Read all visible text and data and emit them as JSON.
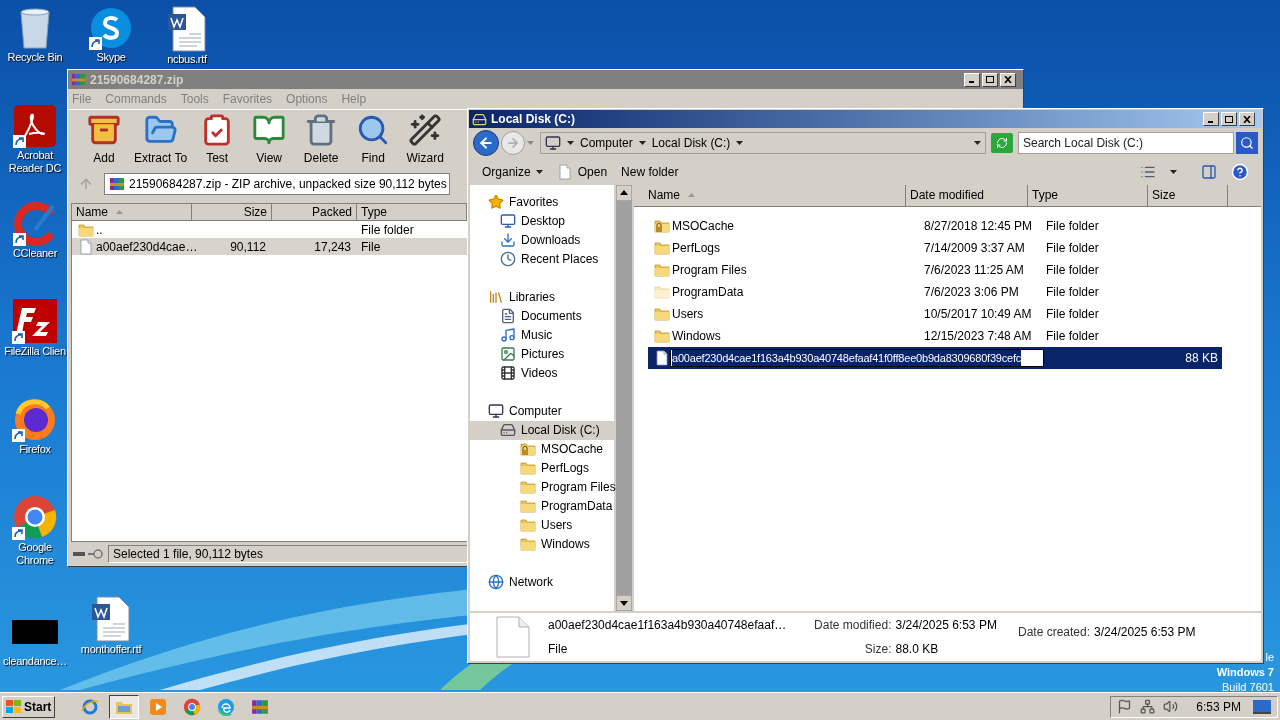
{
  "desktop": {
    "icons": [
      {
        "label": "Recycle Bin",
        "kind": "recycle",
        "shortcut": false
      },
      {
        "label": "Skype",
        "kind": "skype",
        "shortcut": true
      },
      {
        "label": "ncbus.rtf",
        "kind": "word",
        "shortcut": false
      },
      {
        "label": "Acrobat Reader DC",
        "kind": "acrobat",
        "shortcut": true
      },
      {
        "label": "CCleaner",
        "kind": "ccleaner",
        "shortcut": true
      },
      {
        "label": "FileZilla Clien",
        "kind": "filezilla",
        "shortcut": true
      },
      {
        "label": "Firefox",
        "kind": "firefox",
        "shortcut": true
      },
      {
        "label": "Google Chrome",
        "kind": "chrome",
        "shortcut": true
      },
      {
        "label": "cleandance…",
        "kind": "thumbnail",
        "shortcut": false
      },
      {
        "label": "monthoffer.rtf",
        "kind": "word",
        "shortcut": false
      }
    ],
    "os_lines": [
      "le",
      "Windows 7",
      "Build 7601"
    ]
  },
  "winrar": {
    "title": "21590684287.zip",
    "active": false,
    "menu": [
      "File",
      "Commands",
      "Tools",
      "Favorites",
      "Options",
      "Help"
    ],
    "tools": [
      {
        "label": "Add",
        "kind": "add"
      },
      {
        "label": "Extract To",
        "kind": "extract"
      },
      {
        "label": "Test",
        "kind": "test"
      },
      {
        "label": "View",
        "kind": "view"
      },
      {
        "label": "Delete",
        "kind": "delete"
      },
      {
        "label": "Find",
        "kind": "find"
      },
      {
        "label": "Wizard",
        "kind": "wizard"
      }
    ],
    "address": "21590684287.zip - ZIP archive, unpacked size 90,112 bytes",
    "columns": [
      "Name",
      "Size",
      "Packed",
      "Type"
    ],
    "rows": [
      {
        "kind": "folder",
        "name": "..",
        "type": "File folder",
        "selected": false
      },
      {
        "kind": "file",
        "name": "a00aef230d4cae…",
        "size": "90,112",
        "packed": "17,243",
        "type": "File",
        "selected": true
      }
    ],
    "status": "Selected 1 file, 90,112 bytes"
  },
  "explorer": {
    "title": "Local Disk (C:)",
    "active": true,
    "breadcrumb": [
      "Computer",
      "Local Disk (C:)"
    ],
    "search": {
      "placeholder": "Search Local Disk (C:)"
    },
    "commands": [
      {
        "label": "Organize",
        "kind": "menu"
      },
      {
        "label": "Open",
        "kind": "open"
      },
      {
        "label": "New folder",
        "kind": "plain"
      }
    ],
    "nav": [
      {
        "label": "Favorites",
        "kind": "star",
        "selected": false,
        "children": [
          {
            "label": "Desktop",
            "kind": "desktop",
            "selected": false
          },
          {
            "label": "Downloads",
            "kind": "downloads",
            "selected": false
          },
          {
            "label": "Recent Places",
            "kind": "recent",
            "selected": false
          }
        ]
      },
      {
        "label": "Libraries",
        "kind": "library",
        "selected": false,
        "children": [
          {
            "label": "Documents",
            "kind": "documents",
            "selected": false
          },
          {
            "label": "Music",
            "kind": "music",
            "selected": false
          },
          {
            "label": "Pictures",
            "kind": "pictures",
            "selected": false
          },
          {
            "label": "Videos",
            "kind": "videos",
            "selected": false
          }
        ]
      },
      {
        "label": "Computer",
        "kind": "computer",
        "selected": false,
        "children": [
          {
            "label": "Local Disk (C:)",
            "kind": "drive",
            "selected": true,
            "children": [
              {
                "label": "MSOCache",
                "kind": "folder-locked",
                "selected": false
              },
              {
                "label": "PerfLogs",
                "kind": "folder",
                "selected": false
              },
              {
                "label": "Program Files",
                "kind": "folder",
                "selected": false
              },
              {
                "label": "ProgramData",
                "kind": "folder",
                "selected": false
              },
              {
                "label": "Users",
                "kind": "folder",
                "selected": false
              },
              {
                "label": "Windows",
                "kind": "folder",
                "selected": false
              }
            ]
          }
        ]
      },
      {
        "label": "Network",
        "kind": "network",
        "selected": false
      }
    ],
    "columns": [
      "Name",
      "Date modified",
      "Type",
      "Size"
    ],
    "rows": [
      {
        "kind": "folder-locked",
        "name": "MSOCache",
        "date": "8/27/2018 12:45 PM",
        "type": "File folder",
        "selected": false,
        "editing": false
      },
      {
        "kind": "folder",
        "name": "PerfLogs",
        "date": "7/14/2009 3:37 AM",
        "type": "File folder",
        "selected": false,
        "editing": false
      },
      {
        "kind": "folder",
        "name": "Program Files",
        "date": "7/6/2023 11:25 AM",
        "type": "File folder",
        "selected": false,
        "editing": false
      },
      {
        "kind": "folder-hidden",
        "name": "ProgramData",
        "date": "7/6/2023 3:06 PM",
        "type": "File folder",
        "selected": false,
        "editing": false
      },
      {
        "kind": "folder",
        "name": "Users",
        "date": "10/5/2017 10:49 AM",
        "type": "File folder",
        "selected": false,
        "editing": false
      },
      {
        "kind": "folder",
        "name": "Windows",
        "date": "12/15/2023 7:48 AM",
        "type": "File folder",
        "selected": false,
        "editing": false
      },
      {
        "kind": "file",
        "name": "a00aef230d4cae1f163a4b930a40748efaaf41f0ff8ee0b9da8309680f39cefc",
        "size": "88 KB",
        "selected": true,
        "editing": true
      }
    ],
    "details": {
      "name": "a00aef230d4cae1f163a4b930a40748efaaf…",
      "type": "File",
      "fields": [
        {
          "label": "Date modified:",
          "value": "3/24/2025 6:53 PM"
        },
        {
          "label": "Size:",
          "value": "88.0 KB"
        },
        {
          "label": "Date created:",
          "value": "3/24/2025 6:53 PM"
        }
      ]
    }
  },
  "taskbar": {
    "start": "Start",
    "apps": [
      {
        "kind": "ie",
        "active": false
      },
      {
        "kind": "explorer",
        "active": true
      },
      {
        "kind": "media",
        "active": false
      },
      {
        "kind": "chrome",
        "active": false
      },
      {
        "kind": "edge",
        "active": false
      },
      {
        "kind": "winrar",
        "active": false
      }
    ],
    "clock": "6:53 PM"
  }
}
